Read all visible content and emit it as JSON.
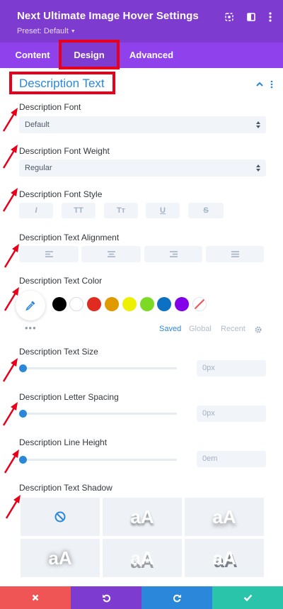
{
  "header": {
    "title": "Next Ultimate Image Hover Settings",
    "preset": "Preset: Default",
    "icons": [
      "target-icon",
      "split-view-icon",
      "more-vertical-icon"
    ],
    "bg": "#7e3bd0"
  },
  "tabs": [
    {
      "label": "Content",
      "active": false
    },
    {
      "label": "Design",
      "active": true
    },
    {
      "label": "Advanced",
      "active": false
    }
  ],
  "section": {
    "title": "Description Text",
    "accent": "#2b87da"
  },
  "fields": {
    "font": {
      "label": "Description Font",
      "value": "Default"
    },
    "weight": {
      "label": "Description Font Weight",
      "value": "Regular"
    },
    "style": {
      "label": "Description Font Style",
      "buttons": [
        "I",
        "TT",
        "Tт",
        "U",
        "S"
      ]
    },
    "align": {
      "label": "Description Text Alignment",
      "options": [
        "left",
        "center",
        "right",
        "justify"
      ]
    },
    "color": {
      "label": "Description Text Color",
      "swatches": [
        "#000000",
        "#ffffff",
        "#e02b20",
        "#e09900",
        "#edf000",
        "#7cda24",
        "#0c71c3",
        "#8300e9"
      ],
      "more": "•••",
      "palette_tabs": [
        "Saved",
        "Global",
        "Recent"
      ],
      "active_palette": "Saved"
    },
    "size": {
      "label": "Description Text Size",
      "value": "0px"
    },
    "spacing": {
      "label": "Description Letter Spacing",
      "value": "0px"
    },
    "line_height": {
      "label": "Description Line Height",
      "value": "0em"
    },
    "shadow": {
      "label": "Description Text Shadow",
      "preview": "aA"
    }
  },
  "footer": {
    "colors": {
      "cancel": "#ef5555",
      "undo": "#7e3bd0",
      "redo": "#2b87da",
      "save": "#29c4a9"
    }
  },
  "annotation_color": "#e8001a"
}
